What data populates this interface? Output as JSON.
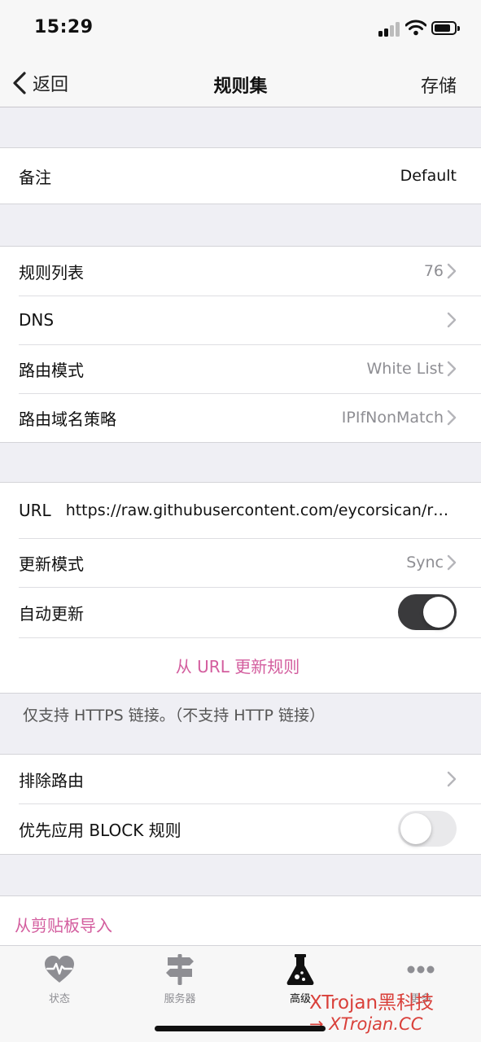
{
  "status_bar": {
    "time": "15:29"
  },
  "nav": {
    "back_label": "返回",
    "title": "规则集",
    "save_label": "存储"
  },
  "section_note": {
    "label": "备注",
    "value": "Default"
  },
  "section_rules": {
    "rows": [
      {
        "label": "规则列表",
        "value": "76"
      },
      {
        "label": "DNS",
        "value": ""
      },
      {
        "label": "路由模式",
        "value": "White List"
      },
      {
        "label": "路由域名策略",
        "value": "IPIfNonMatch"
      }
    ]
  },
  "section_url": {
    "url_label": "URL",
    "url_value": "https://raw.githubusercontent.com/eycorsican/rule-sets/master/kitsunebi_default.conf",
    "update_mode_label": "更新模式",
    "update_mode_value": "Sync",
    "auto_update_label": "自动更新",
    "auto_update_on": true,
    "update_link": "从 URL 更新规则",
    "note": "仅支持 HTTPS 链接。（不支持 HTTP 链接）"
  },
  "section_exclude": {
    "exclude_label": "排除路由",
    "block_label": "优先应用 BLOCK 规则",
    "block_on": false
  },
  "import_link": "从剪贴板导入",
  "tabs": [
    {
      "label": "状态",
      "icon": "heart-pulse-icon"
    },
    {
      "label": "服务器",
      "icon": "signpost-icon"
    },
    {
      "label": "高级",
      "icon": "flask-icon"
    },
    {
      "label": "更多",
      "icon": "more-dots-icon"
    }
  ],
  "watermark": {
    "text": "XTrojan黑科技",
    "url": "XTrojan.CC"
  },
  "colors": {
    "accent": "#d35d9e",
    "toggle_on": "#3a3a3c",
    "watermark": "#d9403a"
  }
}
